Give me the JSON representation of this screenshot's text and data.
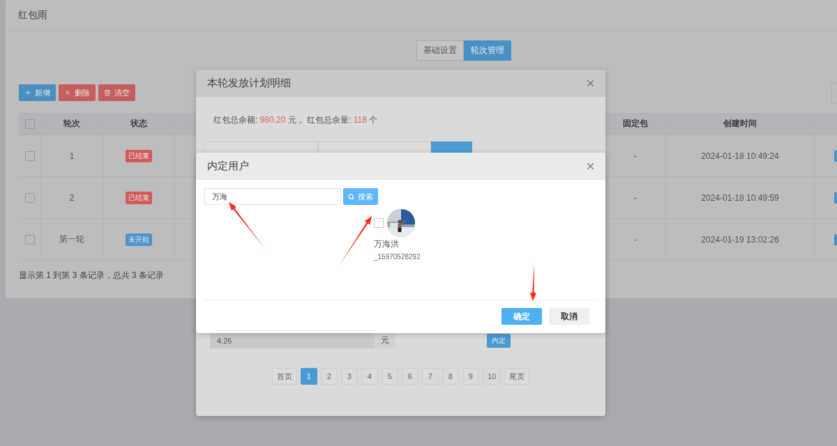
{
  "page": {
    "title": "红包雨"
  },
  "tabs": [
    {
      "label": "基础设置",
      "selected": false
    },
    {
      "label": "轮次管理",
      "selected": true
    }
  ],
  "toolbar": [
    {
      "label": "新增",
      "kind": "add"
    },
    {
      "label": "删除",
      "kind": "delete"
    },
    {
      "label": "清空",
      "kind": "clear"
    }
  ],
  "table": {
    "header_checked": false,
    "columns": [
      "轮次",
      "状态",
      "固定包",
      "创建时间"
    ],
    "rows": [
      {
        "round": "1",
        "status": "已结束",
        "kind": "ended",
        "fixed": "-",
        "created": "2024-01-18 10:49:24",
        "checked": false
      },
      {
        "round": "2",
        "status": "已结束",
        "kind": "ended",
        "fixed": "-",
        "created": "2024-01-18 10:49:59",
        "checked": false
      },
      {
        "round": "第一轮",
        "status": "未开始",
        "kind": "pending",
        "fixed": "-",
        "created": "2024-01-19 13:02:26",
        "checked": false
      }
    ]
  },
  "footer": "显示第 1 到第 3 条记录，总共 3 条记录",
  "plan_dialog": {
    "title": "本轮发放计划明细",
    "summary": {
      "amount_label": "红包总余额:",
      "amount": "980.20",
      "amount_unit": "元，",
      "count_label": "红包总余量:",
      "count": "118",
      "count_unit": "个"
    },
    "amount_row": {
      "value": "4.26",
      "unit": "元",
      "button": "内定"
    },
    "pagination": [
      {
        "label": "首页",
        "selected": false
      },
      {
        "label": "1",
        "selected": true
      },
      {
        "label": "2",
        "selected": false
      },
      {
        "label": "3",
        "selected": false
      },
      {
        "label": "4",
        "selected": false
      },
      {
        "label": "5",
        "selected": false
      },
      {
        "label": "6",
        "selected": false
      },
      {
        "label": "7",
        "selected": false
      },
      {
        "label": "8",
        "selected": false
      },
      {
        "label": "9",
        "selected": false
      },
      {
        "label": "10",
        "selected": false
      },
      {
        "label": "尾页",
        "selected": false
      }
    ]
  },
  "user_dialog": {
    "title": "内定用户",
    "search": {
      "value": "万海"
    },
    "search_button": "搜索",
    "users": [
      {
        "name": "万海洪",
        "id": "_15970528292",
        "checked": false
      }
    ],
    "buttons": [
      {
        "label": "确定",
        "kind": "primary"
      },
      {
        "label": "取消",
        "kind": "default"
      }
    ]
  }
}
